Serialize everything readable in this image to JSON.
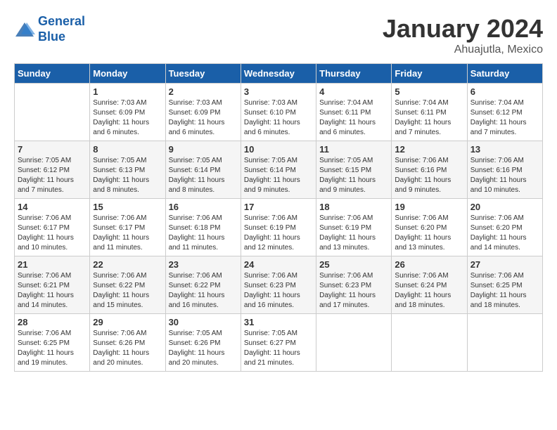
{
  "header": {
    "logo_line1": "General",
    "logo_line2": "Blue",
    "month": "January 2024",
    "location": "Ahuajutla, Mexico"
  },
  "days_of_week": [
    "Sunday",
    "Monday",
    "Tuesday",
    "Wednesday",
    "Thursday",
    "Friday",
    "Saturday"
  ],
  "weeks": [
    [
      {
        "day": null
      },
      {
        "day": "1",
        "sunrise": "7:03 AM",
        "sunset": "6:09 PM",
        "daylight": "11 hours and 6 minutes."
      },
      {
        "day": "2",
        "sunrise": "7:03 AM",
        "sunset": "6:09 PM",
        "daylight": "11 hours and 6 minutes."
      },
      {
        "day": "3",
        "sunrise": "7:03 AM",
        "sunset": "6:10 PM",
        "daylight": "11 hours and 6 minutes."
      },
      {
        "day": "4",
        "sunrise": "7:04 AM",
        "sunset": "6:11 PM",
        "daylight": "11 hours and 6 minutes."
      },
      {
        "day": "5",
        "sunrise": "7:04 AM",
        "sunset": "6:11 PM",
        "daylight": "11 hours and 7 minutes."
      },
      {
        "day": "6",
        "sunrise": "7:04 AM",
        "sunset": "6:12 PM",
        "daylight": "11 hours and 7 minutes."
      }
    ],
    [
      {
        "day": "7",
        "sunrise": "7:05 AM",
        "sunset": "6:12 PM",
        "daylight": "11 hours and 7 minutes."
      },
      {
        "day": "8",
        "sunrise": "7:05 AM",
        "sunset": "6:13 PM",
        "daylight": "11 hours and 8 minutes."
      },
      {
        "day": "9",
        "sunrise": "7:05 AM",
        "sunset": "6:14 PM",
        "daylight": "11 hours and 8 minutes."
      },
      {
        "day": "10",
        "sunrise": "7:05 AM",
        "sunset": "6:14 PM",
        "daylight": "11 hours and 9 minutes."
      },
      {
        "day": "11",
        "sunrise": "7:05 AM",
        "sunset": "6:15 PM",
        "daylight": "11 hours and 9 minutes."
      },
      {
        "day": "12",
        "sunrise": "7:06 AM",
        "sunset": "6:16 PM",
        "daylight": "11 hours and 9 minutes."
      },
      {
        "day": "13",
        "sunrise": "7:06 AM",
        "sunset": "6:16 PM",
        "daylight": "11 hours and 10 minutes."
      }
    ],
    [
      {
        "day": "14",
        "sunrise": "7:06 AM",
        "sunset": "6:17 PM",
        "daylight": "11 hours and 10 minutes."
      },
      {
        "day": "15",
        "sunrise": "7:06 AM",
        "sunset": "6:17 PM",
        "daylight": "11 hours and 11 minutes."
      },
      {
        "day": "16",
        "sunrise": "7:06 AM",
        "sunset": "6:18 PM",
        "daylight": "11 hours and 11 minutes."
      },
      {
        "day": "17",
        "sunrise": "7:06 AM",
        "sunset": "6:19 PM",
        "daylight": "11 hours and 12 minutes."
      },
      {
        "day": "18",
        "sunrise": "7:06 AM",
        "sunset": "6:19 PM",
        "daylight": "11 hours and 13 minutes."
      },
      {
        "day": "19",
        "sunrise": "7:06 AM",
        "sunset": "6:20 PM",
        "daylight": "11 hours and 13 minutes."
      },
      {
        "day": "20",
        "sunrise": "7:06 AM",
        "sunset": "6:20 PM",
        "daylight": "11 hours and 14 minutes."
      }
    ],
    [
      {
        "day": "21",
        "sunrise": "7:06 AM",
        "sunset": "6:21 PM",
        "daylight": "11 hours and 14 minutes."
      },
      {
        "day": "22",
        "sunrise": "7:06 AM",
        "sunset": "6:22 PM",
        "daylight": "11 hours and 15 minutes."
      },
      {
        "day": "23",
        "sunrise": "7:06 AM",
        "sunset": "6:22 PM",
        "daylight": "11 hours and 16 minutes."
      },
      {
        "day": "24",
        "sunrise": "7:06 AM",
        "sunset": "6:23 PM",
        "daylight": "11 hours and 16 minutes."
      },
      {
        "day": "25",
        "sunrise": "7:06 AM",
        "sunset": "6:23 PM",
        "daylight": "11 hours and 17 minutes."
      },
      {
        "day": "26",
        "sunrise": "7:06 AM",
        "sunset": "6:24 PM",
        "daylight": "11 hours and 18 minutes."
      },
      {
        "day": "27",
        "sunrise": "7:06 AM",
        "sunset": "6:25 PM",
        "daylight": "11 hours and 18 minutes."
      }
    ],
    [
      {
        "day": "28",
        "sunrise": "7:06 AM",
        "sunset": "6:25 PM",
        "daylight": "11 hours and 19 minutes."
      },
      {
        "day": "29",
        "sunrise": "7:06 AM",
        "sunset": "6:26 PM",
        "daylight": "11 hours and 20 minutes."
      },
      {
        "day": "30",
        "sunrise": "7:05 AM",
        "sunset": "6:26 PM",
        "daylight": "11 hours and 20 minutes."
      },
      {
        "day": "31",
        "sunrise": "7:05 AM",
        "sunset": "6:27 PM",
        "daylight": "11 hours and 21 minutes."
      },
      {
        "day": null
      },
      {
        "day": null
      },
      {
        "day": null
      }
    ]
  ],
  "labels": {
    "sunrise_label": "Sunrise:",
    "sunset_label": "Sunset:",
    "daylight_label": "Daylight:"
  }
}
